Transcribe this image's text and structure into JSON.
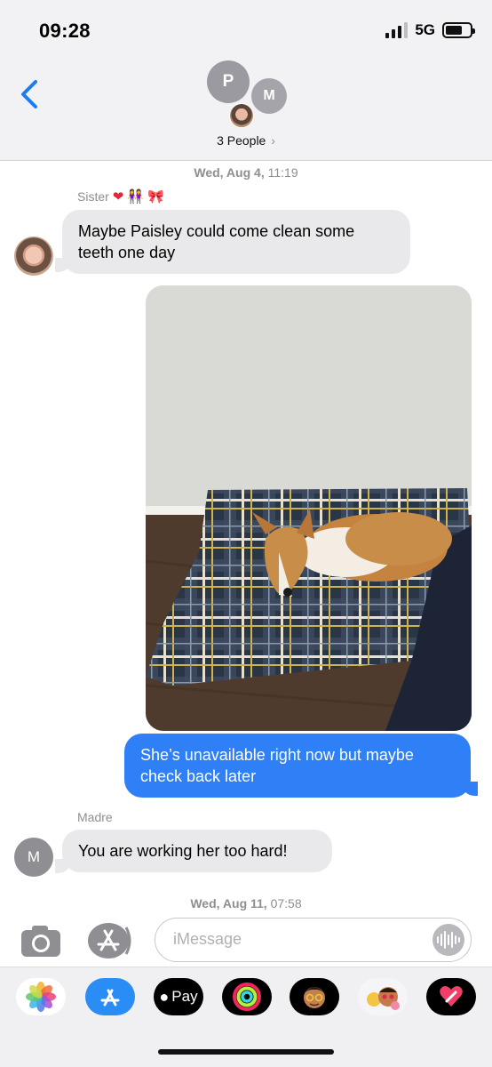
{
  "status_bar": {
    "time": "09:28",
    "network": "5G"
  },
  "header": {
    "group_avatars": [
      {
        "initial": "P"
      },
      {
        "initial": "M"
      }
    ],
    "participants_label": "3 People",
    "chevron": "›"
  },
  "messages": {
    "timestamp1": {
      "day": "Wed, Aug 4,",
      "time": "11:19"
    },
    "sister_name": "Sister",
    "sister_emojis": [
      "red-heart",
      "two-women-holding-hands",
      "pink-bow"
    ],
    "sister_text": "Maybe Paisley could come clean some teeth one day",
    "sister_text_line1": "Maybe Paisley could come clean some",
    "sister_text_line2": "teeth one day",
    "photo": {
      "icon": "corgi-on-plaid-bed-photo"
    },
    "sent_text_line1": "She’s unavailable right now but maybe",
    "sent_text_line2": "check back later",
    "madre_name": "Madre",
    "madre_initial": "M",
    "madre_text": "You are working her too hard!",
    "timestamp2": {
      "day": "Wed, Aug 11,",
      "time": "07:58"
    }
  },
  "input_bar": {
    "placeholder": "iMessage",
    "camera_icon": "camera-icon",
    "apps_icon": "app-store-icon",
    "voice_icon": "waveform-icon"
  },
  "app_drawer": [
    {
      "name": "photos-app-icon"
    },
    {
      "name": "app-store-app-icon"
    },
    {
      "name": "apple-pay-app-icon",
      "label": "Pay"
    },
    {
      "name": "fitness-rings-app-icon"
    },
    {
      "name": "memoji-app-icon"
    },
    {
      "name": "memoji-stickers-app-icon"
    },
    {
      "name": "digital-touch-app-icon"
    }
  ],
  "colors": {
    "accent_blue": "#2f7ff6",
    "incoming_bubble": "#e9e9eb",
    "back_chevron": "#1e7cf2",
    "secondary_text": "#8e8e93"
  }
}
